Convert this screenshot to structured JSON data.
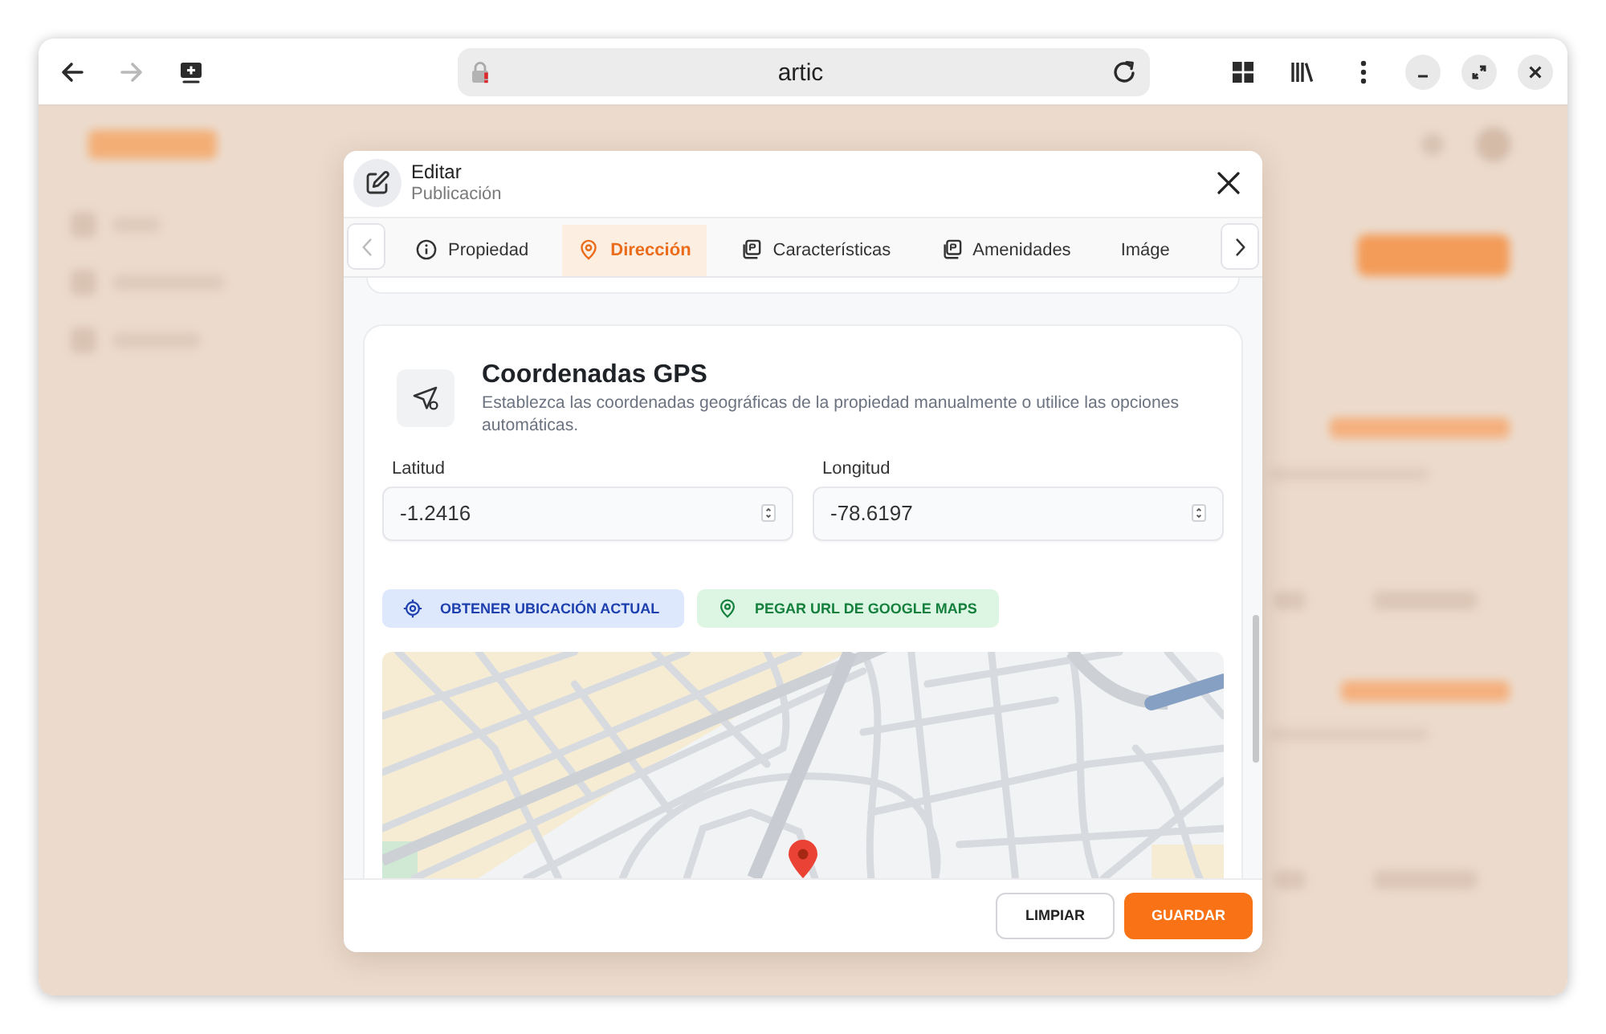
{
  "browser": {
    "navigation": [
      {
        "kind": "back",
        "disabled": false
      },
      {
        "kind": "forward",
        "disabled": true
      },
      {
        "kind": "screen",
        "disabled": false
      }
    ],
    "address": {
      "text": "artic",
      "secure": false
    }
  },
  "dialog": {
    "title": "Editar",
    "subtitle": "Publicación",
    "tab_arrows": {
      "previous_disabled": true,
      "next_disabled": false
    },
    "tabs": [
      {
        "label": "Propiedad",
        "kind": "info",
        "selected": false
      },
      {
        "label": "Dirección",
        "kind": "pin",
        "selected": true
      },
      {
        "label": "Características",
        "kind": "stack",
        "selected": false
      },
      {
        "label": "Amenidades",
        "kind": "stack",
        "selected": false
      },
      {
        "label": "Imáge",
        "kind": "text",
        "selected": false
      }
    ],
    "section": {
      "title": "Coordenadas GPS",
      "description": "Establezca las coordenadas geográficas de la propiedad manualmente o utilice las opciones automáticas.",
      "fields": [
        {
          "label": "Latitud",
          "value": "-1.2416"
        },
        {
          "label": "Longitud",
          "value": "-78.6197"
        }
      ],
      "actions": [
        {
          "kind": "locate",
          "label": "OBTENER UBICACIÓN ACTUAL"
        },
        {
          "kind": "paste_url",
          "label": "PEGAR URL DE GOOGLE MAPS"
        }
      ]
    },
    "footer_buttons": [
      {
        "kind": "secondary",
        "label": "LIMPIAR"
      },
      {
        "kind": "primary",
        "label": "GUARDAR"
      }
    ]
  }
}
